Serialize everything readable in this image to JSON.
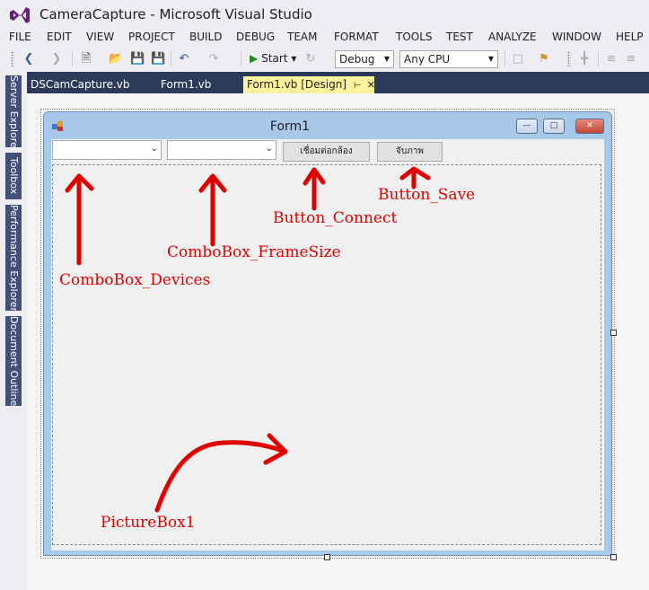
{
  "window": {
    "title": "CameraCapture - Microsoft Visual Studio"
  },
  "menu": {
    "items": [
      "FILE",
      "EDIT",
      "VIEW",
      "PROJECT",
      "BUILD",
      "DEBUG",
      "TEAM",
      "FORMAT",
      "TOOLS",
      "TEST",
      "ANALYZE",
      "WINDOW",
      "HELP"
    ]
  },
  "toolbar": {
    "start_label": "Start",
    "configuration": "Debug",
    "platform": "Any CPU"
  },
  "side_tabs": [
    "Server Explorer",
    "Toolbox",
    "Performance Explorer",
    "Document Outline"
  ],
  "document_tabs": [
    {
      "label": "DSCamCapture.vb",
      "active": false
    },
    {
      "label": "Form1.vb",
      "active": false
    },
    {
      "label": "Form1.vb [Design]",
      "active": true
    }
  ],
  "form": {
    "title": "Form1",
    "button_connect_label": "เชื่อมต่อกล้อง",
    "button_save_label": "จับภาพ"
  },
  "annotations": {
    "combobox_devices": "ComboBox_Devices",
    "combobox_framesize": "ComboBox_FrameSize",
    "button_connect": "Button_Connect",
    "button_save": "Button_Save",
    "picturebox": "PictureBox1"
  },
  "colors": {
    "annotation": "#e00000",
    "tab_well": "#2a3a58",
    "active_tab": "#fff29d",
    "form_border": "#a8c8ea"
  }
}
